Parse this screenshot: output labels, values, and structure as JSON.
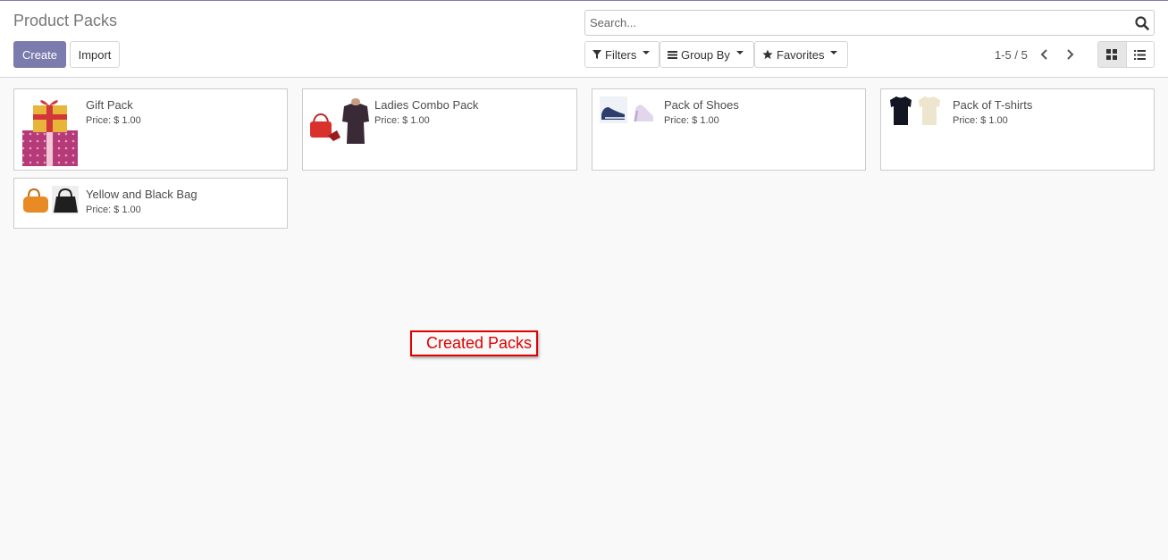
{
  "header": {
    "title": "Product Packs",
    "create_label": "Create",
    "import_label": "Import"
  },
  "search": {
    "placeholder": "Search...",
    "value": ""
  },
  "filters": {
    "filters_label": "Filters",
    "groupby_label": "Group By",
    "favorites_label": "Favorites"
  },
  "pager": {
    "value": "1-5 / 5"
  },
  "view": {
    "active": "kanban",
    "options": [
      "kanban",
      "list"
    ]
  },
  "packs": [
    {
      "name": "Gift Pack",
      "price": "Price: $ 1.00",
      "images": [
        "gift-boxes"
      ]
    },
    {
      "name": "Ladies Combo Pack",
      "price": "Price: $ 1.00",
      "images": [
        "red-handbag",
        "shoe",
        "womens-top"
      ]
    },
    {
      "name": "Pack of Shoes",
      "price": "Price: $ 1.00",
      "images": [
        "blue-loafer",
        "high-heel"
      ]
    },
    {
      "name": "Pack of T-shirts",
      "price": "Price: $ 1.00",
      "images": [
        "black-tshirt",
        "cream-tshirt"
      ]
    },
    {
      "name": "Yellow and Black Bag",
      "price": "Price: $ 1.00",
      "images": [
        "orange-bag",
        "black-bag"
      ]
    }
  ],
  "annotation": {
    "text": "Created Packs"
  },
  "colors": {
    "primary": "#7c7bad",
    "annotation": "#e00000",
    "background": "#f9f9f9"
  }
}
